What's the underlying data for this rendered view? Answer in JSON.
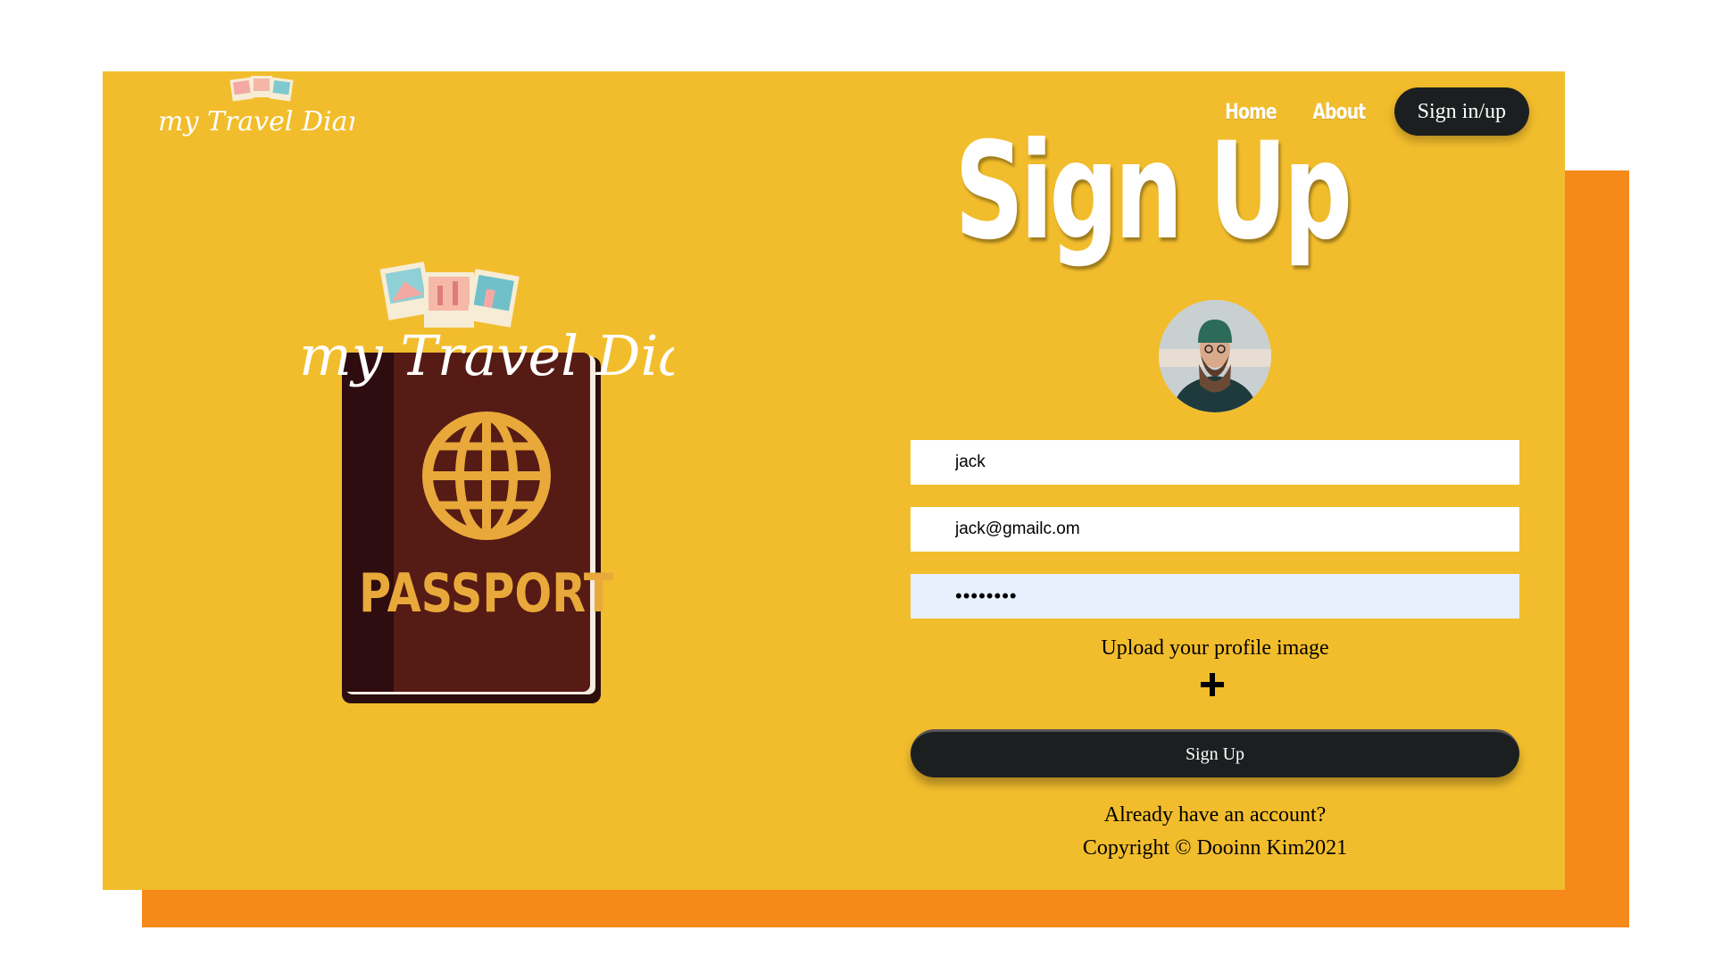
{
  "brand": {
    "logo_text": "my Travel Diary"
  },
  "nav": {
    "home": "Home",
    "about": "About",
    "signin": "Sign in/up"
  },
  "illustration": {
    "passport_text": "PASSPORT"
  },
  "form": {
    "title": "Sign Up",
    "username_value": "jack",
    "email_value": "jack@gmailc.om",
    "password_value": "••••••••",
    "upload_label": "Upload your profile image",
    "submit_label": "Sign Up",
    "already_account": "Already have an account?",
    "copyright": "Copyright © Dooinn Kim2021"
  },
  "colors": {
    "card": "#F2BD2C",
    "shadow_card": "#F5891A",
    "button": "#1C1F20",
    "passport": "#561B15",
    "passport_gold": "#E8A93A"
  }
}
